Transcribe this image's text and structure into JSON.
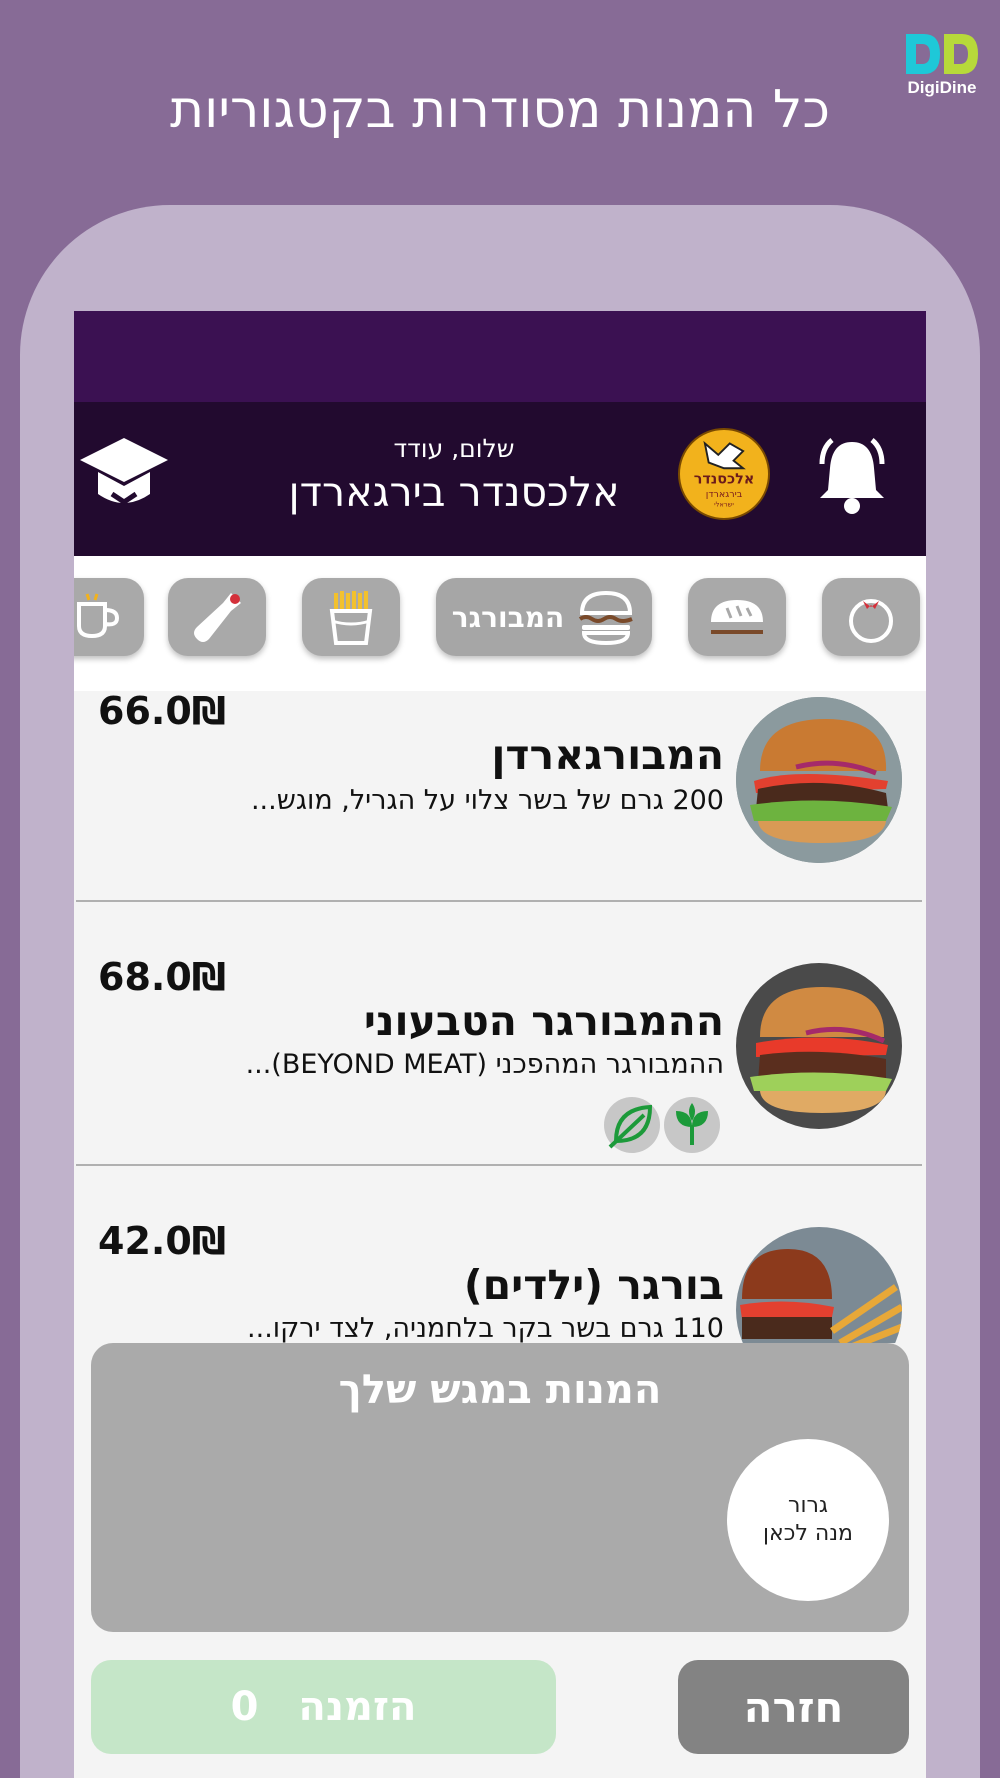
{
  "branding": {
    "logo_text": "DigiDine",
    "logo_colors": {
      "left": "#1ec8d8",
      "right": "#b7d93a"
    },
    "headline": "כל המנות מסודרות בקטגוריות"
  },
  "header": {
    "greeting": "שלום, עודד",
    "restaurant_name": "אלכסנדר בירגארדן",
    "restaurant_logo_text": "אלכסנדר",
    "restaurant_logo_sub": "בירגארדן",
    "restaurant_logo_sub2": "ישראלי",
    "icons": {
      "left": "graduation-cap-icon",
      "right": "bell-icon"
    }
  },
  "categories": [
    {
      "icon": "tomato-icon",
      "label": ""
    },
    {
      "icon": "bread-icon",
      "label": ""
    },
    {
      "icon": "burger-icon",
      "label": "המבורגר",
      "active": true
    },
    {
      "icon": "fries-icon",
      "label": ""
    },
    {
      "icon": "bottle-icon",
      "label": ""
    },
    {
      "icon": "coffee-icon",
      "label": ""
    }
  ],
  "dishes": [
    {
      "name": "המבורגארדן",
      "description": "200 גרם של בשר צלוי על הגריל, מוגש...",
      "price": "66.0₪",
      "badges": []
    },
    {
      "name": "ההמבורגר הטבעוני",
      "description": "ההמבורגר המהפכני (BEYOND MEAT)...",
      "price": "68.0₪",
      "badges": [
        "vegan-icon",
        "leaf-icon"
      ]
    },
    {
      "name": "בורגר (ילדים)",
      "description": "110 גרם בשר בקר בלחמניה, לצד ירקו...",
      "price": "42.0₪",
      "badges": []
    }
  ],
  "tray": {
    "title": "המנות במגש שלך",
    "drop_line1": "גרור",
    "drop_line2": "מנה לכאן"
  },
  "actions": {
    "order_label": "הזמנה",
    "order_count": "0",
    "back_label": "חזרה"
  },
  "colors": {
    "background": "#876b96",
    "phone": "#c0b2cb",
    "status_bar": "#3b1152",
    "app_header": "#220a2f",
    "order_button": "#c5e6c8",
    "back_button": "#838383"
  }
}
